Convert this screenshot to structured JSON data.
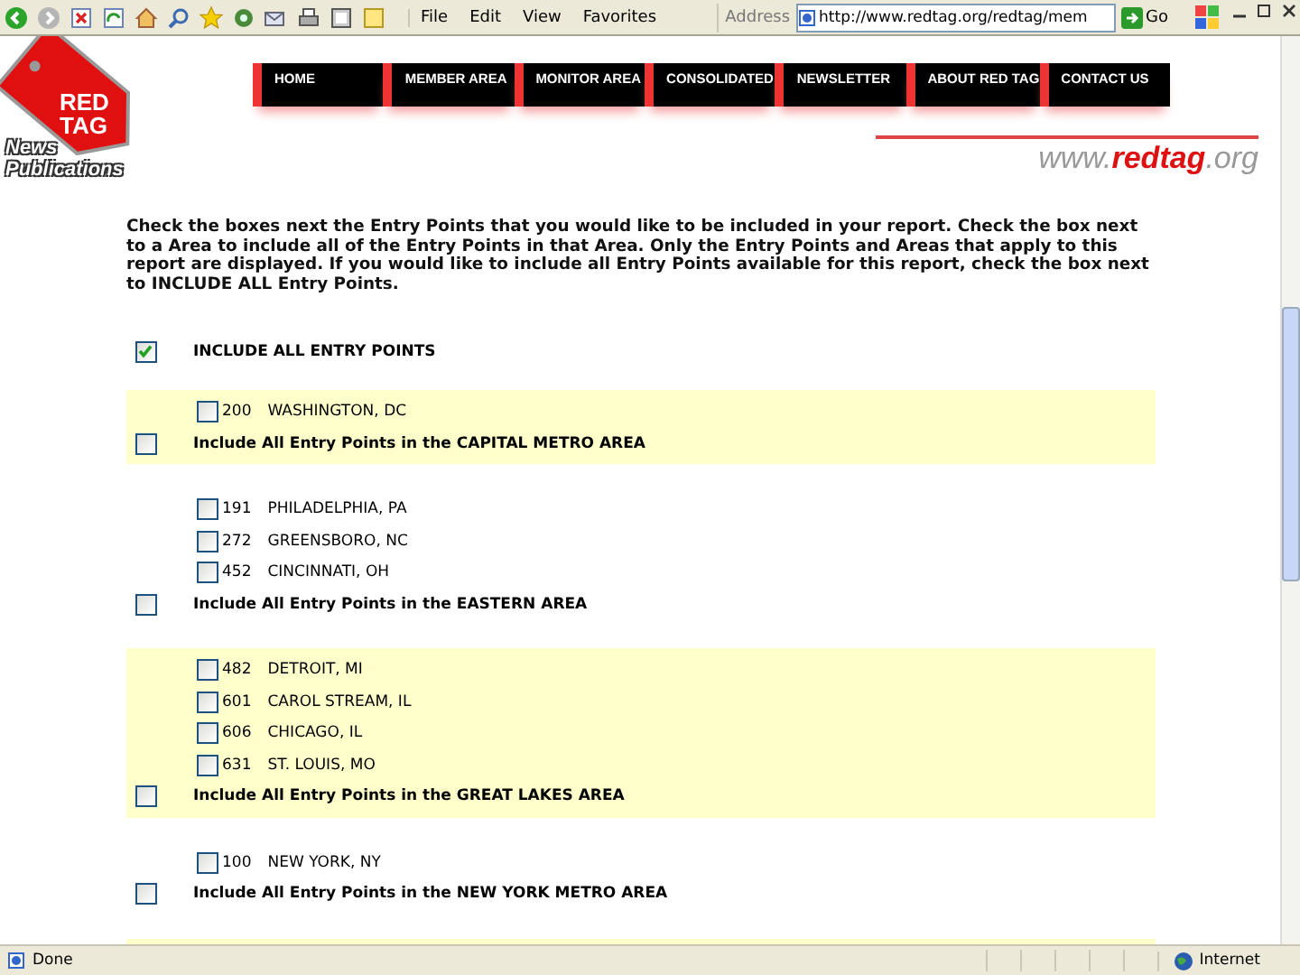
{
  "browser": {
    "menu": [
      "File",
      "Edit",
      "View",
      "Favorites"
    ],
    "address_label": "Address",
    "address": "http://www.redtag.org/redtag/mem",
    "go": "Go"
  },
  "logo": {
    "tag_text": [
      "RED",
      "TAG"
    ],
    "brand_text": [
      "News",
      "Publications"
    ]
  },
  "nav": [
    "HOME",
    "MEMBER AREA",
    "MONITOR AREA",
    "CONSOLIDATED",
    "NEWSLETTER",
    "ABOUT RED TAG",
    "CONTACT US"
  ],
  "site_url": "www.**redtag**.org",
  "instructions": "Check the boxes next the Entry Points that you would like to be included in your report. Check the box next to a Area to include all of the Entry Points in that Area. Only the Entry Points and Areas that apply to this report are displayed. If you would like to include all Entry Points available for this report, check the box next to INCLUDE ALL Entry Points.",
  "include_all": {
    "label": "INCLUDE ALL ENTRY POINTS",
    "checked": true
  },
  "areas": [
    {
      "highlighted": true,
      "points": [
        {
          "code": "200",
          "name": "WASHINGTON, DC",
          "checked": false
        }
      ],
      "label": "Include All Entry Points in the CAPITAL METRO AREA",
      "checked": false
    },
    {
      "highlighted": false,
      "points": [
        {
          "code": "191",
          "name": "PHILADELPHIA, PA",
          "checked": false
        },
        {
          "code": "272",
          "name": "GREENSBORO, NC",
          "checked": false
        },
        {
          "code": "452",
          "name": "CINCINNATI, OH",
          "checked": false
        }
      ],
      "label": "Include All Entry Points in the EASTERN AREA",
      "checked": false
    },
    {
      "highlighted": true,
      "points": [
        {
          "code": "482",
          "name": "DETROIT, MI",
          "checked": false
        },
        {
          "code": "601",
          "name": "CAROL STREAM, IL",
          "checked": false
        },
        {
          "code": "606",
          "name": "CHICAGO, IL",
          "checked": false
        },
        {
          "code": "631",
          "name": "ST. LOUIS, MO",
          "checked": false
        }
      ],
      "label": "Include All Entry Points in the GREAT LAKES AREA",
      "checked": false
    },
    {
      "highlighted": false,
      "points": [
        {
          "code": "100",
          "name": "NEW YORK, NY",
          "checked": false
        }
      ],
      "label": "Include All Entry Points in the NEW YORK METRO AREA",
      "checked": false
    },
    {
      "highlighted": true
    }
  ],
  "status_bar": {
    "text": "Done",
    "zone": "Internet"
  }
}
